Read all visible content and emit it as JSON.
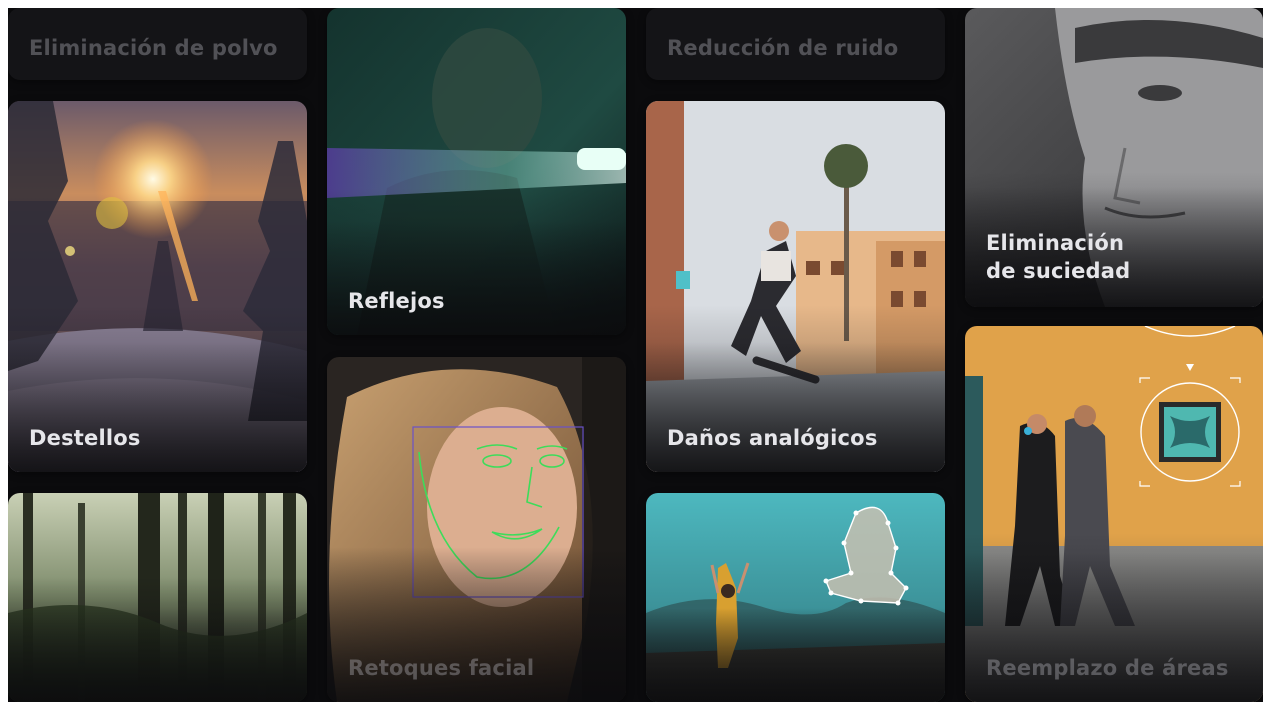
{
  "cards": {
    "dust": "Eliminación de polvo",
    "flares": "Destellos",
    "forest": "",
    "reflections": "Reflejos",
    "face": "Retoques facial",
    "noise": "Reducción de ruido",
    "analog": "Daños analógicos",
    "rotoscope": "",
    "dirt_line1": "Eliminación",
    "dirt_line2": "de suciedad",
    "replace": "Reemplazo de áreas"
  },
  "colors": {
    "background": "#0b0b0d",
    "label": "#e6e6ea",
    "tracking_green": "#3ddc5a",
    "wall_orange": "#e0a24a"
  }
}
